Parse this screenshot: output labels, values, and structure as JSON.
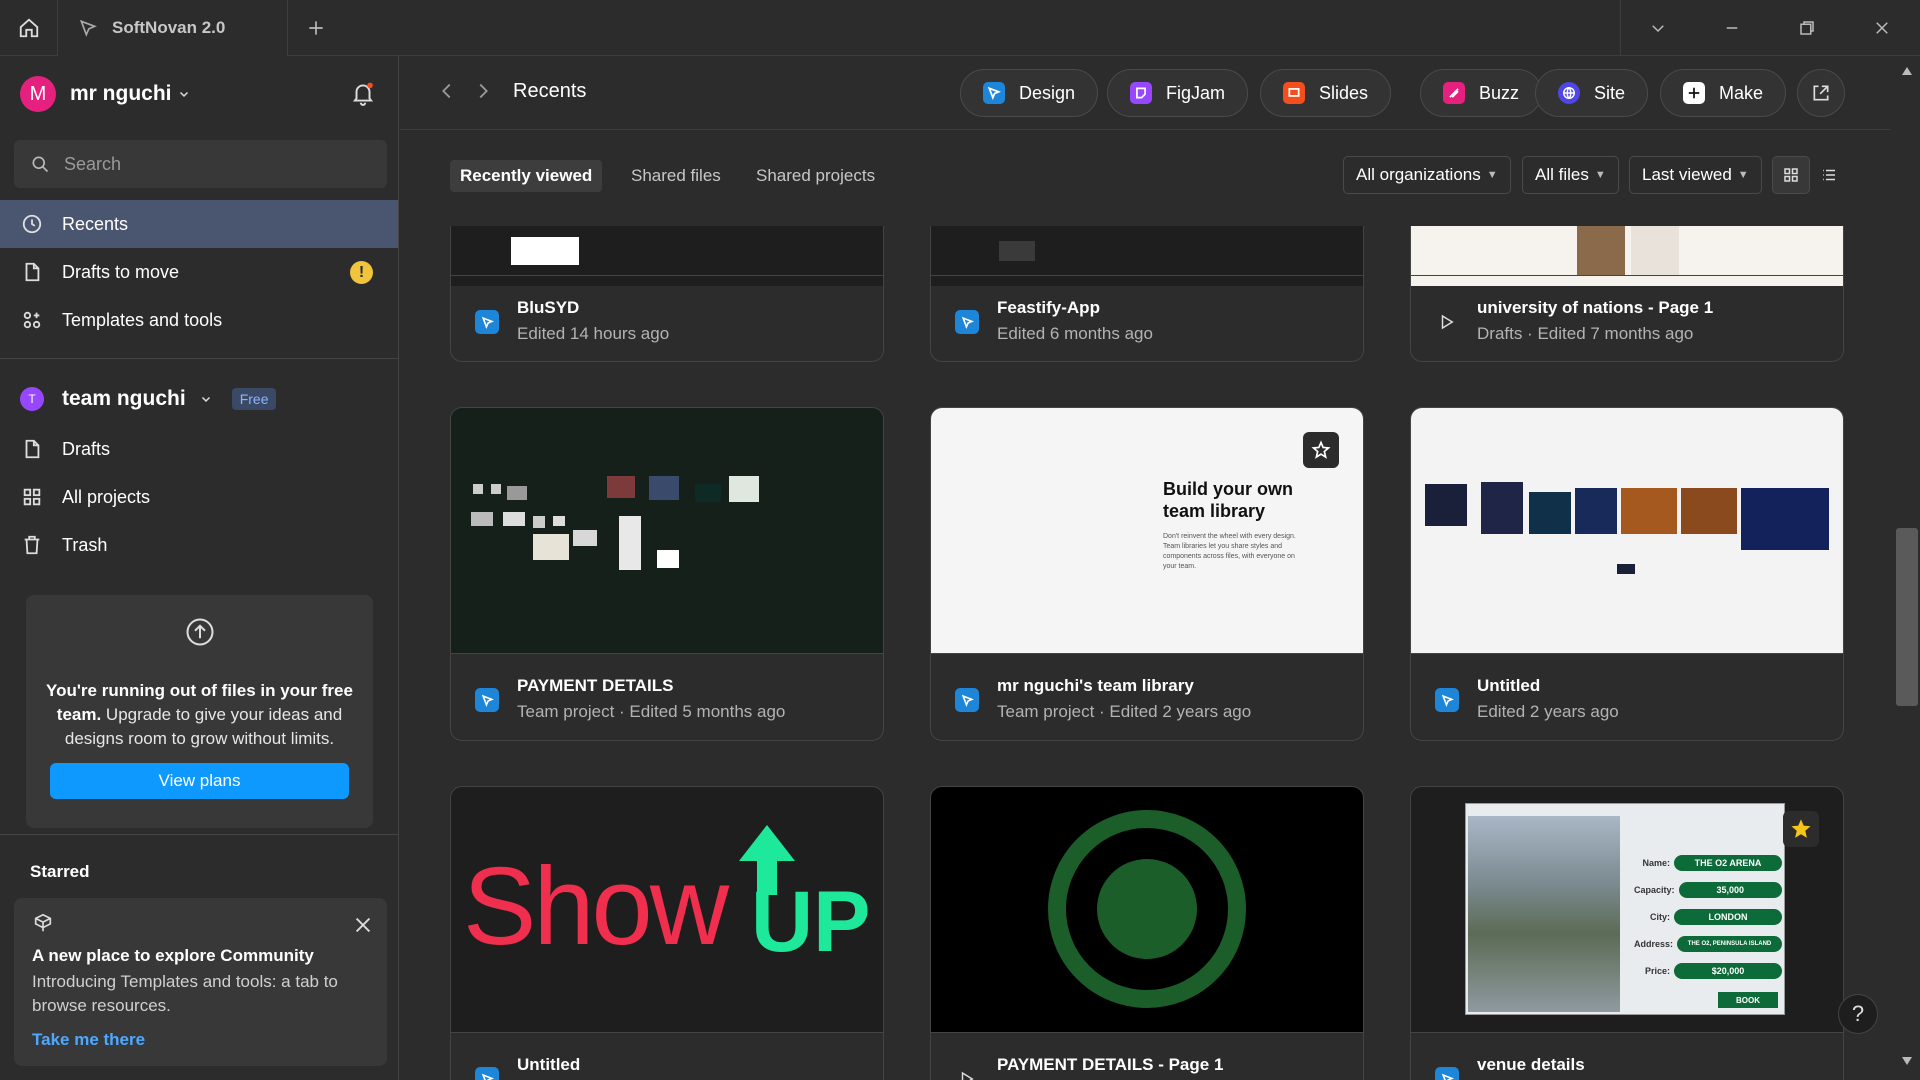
{
  "window": {
    "tab_title": "SoftNovan 2.0"
  },
  "sidebar": {
    "user_initial": "M",
    "username": "mr nguchi",
    "search_placeholder": "Search",
    "nav": [
      {
        "label": "Recents"
      },
      {
        "label": "Drafts to move",
        "badge": "!"
      },
      {
        "label": "Templates and tools"
      }
    ],
    "team": {
      "initial": "T",
      "name": "team nguchi",
      "badge": "Free"
    },
    "team_nav": [
      {
        "label": "Drafts"
      },
      {
        "label": "All projects"
      },
      {
        "label": "Trash"
      }
    ],
    "upgrade": {
      "bold_text": "You're running out of files in your free team.",
      "text": " Upgrade to give your ideas and designs room to grow without limits.",
      "button": "View plans"
    },
    "starred_title": "Starred",
    "community": {
      "title": "A new place to explore Community",
      "body": "Introducing Templates and tools: a tab to browse resources.",
      "link": "Take me there"
    }
  },
  "topbar": {
    "breadcrumb": "Recents",
    "modes": [
      {
        "label": "Design",
        "color": "#1e86d9"
      },
      {
        "label": "FigJam",
        "color": "#9747ff"
      },
      {
        "label": "Slides",
        "color": "#f24e1e"
      },
      {
        "label": "Buzz",
        "color": "#e6207f"
      },
      {
        "label": "Site",
        "color": "#4f46e5"
      },
      {
        "label": "Make",
        "color": "#ffffff"
      }
    ]
  },
  "subtabs": [
    "Recently viewed",
    "Shared files",
    "Shared projects"
  ],
  "filters": [
    "All organizations",
    "All files",
    "Last viewed"
  ],
  "files": [
    {
      "title": "BluSYD",
      "meta": "Edited 14 hours ago"
    },
    {
      "title": "Feastify-App",
      "meta": "Edited 6 months ago"
    },
    {
      "title": "university of nations - Page 1",
      "meta": "Drafts · Edited 7 months ago"
    },
    {
      "title": "PAYMENT DETAILS",
      "meta": "Team project · Edited 5 months ago"
    },
    {
      "title": "mr nguchi's team library",
      "meta": "Team project · Edited 2 years ago"
    },
    {
      "title": "Untitled",
      "meta": "Edited 2 years ago"
    },
    {
      "title": "Untitled",
      "meta": ""
    },
    {
      "title": "PAYMENT DETAILS - Page 1",
      "meta": ""
    },
    {
      "title": "venue details",
      "meta": ""
    }
  ],
  "thumbs": {
    "library_heading": "Build your own team library",
    "library_body": "Don't reinvent the wheel with every design. Team libraries let you share styles and components across files, with everyone on your team.",
    "showup_left": "Show",
    "showup_right": "UP",
    "venue": {
      "rows": [
        {
          "label": "Name:",
          "value": "THE O2 ARENA"
        },
        {
          "label": "Capacity:",
          "value": "35,000"
        },
        {
          "label": "City:",
          "value": "LONDON"
        },
        {
          "label": "Address:",
          "value": "THE O2, PENINSULA ISLAND"
        },
        {
          "label": "Price:",
          "value": "$20,000"
        }
      ],
      "button": "BOOK"
    }
  },
  "help": "?"
}
